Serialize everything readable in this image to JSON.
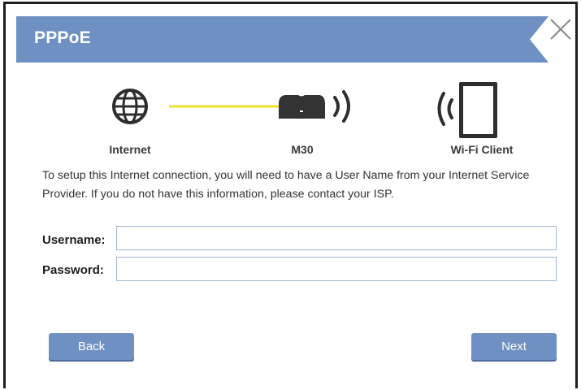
{
  "dialog": {
    "title": "PPPoE"
  },
  "diagram": {
    "internet_label": "Internet",
    "router_label": "M30",
    "client_label": "Wi-Fi Client"
  },
  "description": "To setup this Internet connection, you will need to have a User Name from your Internet Service Provider. If you do not have this information, please contact your ISP.",
  "form": {
    "username_label": "Username:",
    "username_value": "",
    "password_label": "Password:",
    "password_value": ""
  },
  "buttons": {
    "back_label": "Back",
    "next_label": "Next"
  },
  "colors": {
    "header": "#6f90c2",
    "link_line": "#f0e028",
    "button": "#6f90c2",
    "input_border": "#9fb7d6"
  }
}
